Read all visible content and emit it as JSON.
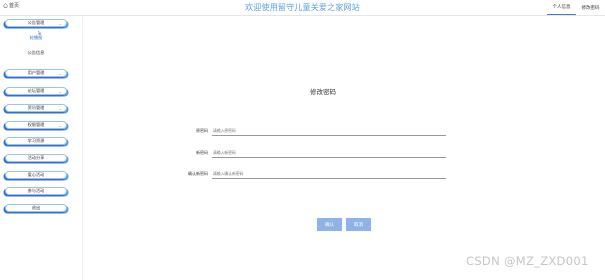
{
  "header": {
    "home_label": "首页",
    "site_title": "欢迎使用留守儿童关爱之家网站",
    "right_tabs": [
      {
        "label": "个人信息",
        "active": true
      },
      {
        "label": "修改密码",
        "active": false
      }
    ]
  },
  "sidebar": {
    "items": [
      {
        "label": "公告管理",
        "type": "button",
        "chevron": true
      },
      {
        "label": "轮播图",
        "type": "sub",
        "active": true
      },
      {
        "label": "公告信息",
        "type": "sub",
        "active": false
      },
      {
        "label": "用户管理",
        "type": "button",
        "chevron": true
      },
      {
        "label": "论坛管理",
        "type": "button",
        "chevron": true
      },
      {
        "label": "资讯管理",
        "type": "button",
        "chevron": true
      },
      {
        "label": "权限管理",
        "type": "button",
        "chevron": true
      },
      {
        "label": "学习资源",
        "type": "button",
        "chevron": false
      },
      {
        "label": "活动分享",
        "type": "button",
        "chevron": false
      },
      {
        "label": "爱心活动",
        "type": "button",
        "chevron": false
      },
      {
        "label": "参与活动",
        "type": "button",
        "chevron": false
      },
      {
        "label": "退出",
        "type": "button",
        "chevron": false
      }
    ]
  },
  "main": {
    "title": "修改密码",
    "fields": [
      {
        "label": "原密码",
        "placeholder": "请输入原密码"
      },
      {
        "label": "新密码",
        "placeholder": "请输入新密码"
      },
      {
        "label": "确认新密码",
        "placeholder": "请输入确认新密码"
      }
    ],
    "confirm_label": "确认",
    "cancel_label": "取消"
  },
  "watermark": "CSDN @MZ_ZXD001",
  "colors": {
    "accent": "#3b7de0",
    "title_blue": "#5aa0e6",
    "button_blue": "#8fb3e6"
  }
}
